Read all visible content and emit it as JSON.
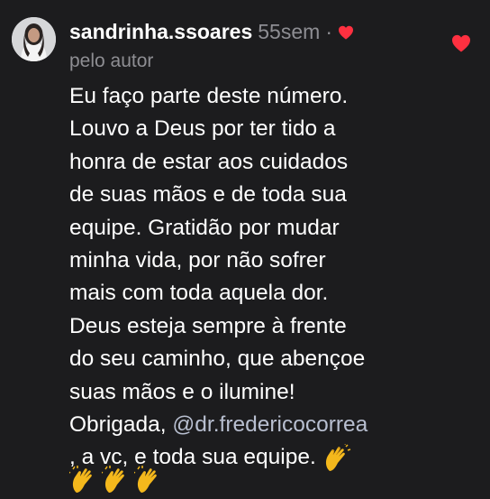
{
  "comment": {
    "username": "sandrinha.ssoares",
    "timestamp": "55sem",
    "separator": "·",
    "author_label": "pelo autor",
    "mention": "@dr.fredericocorrea",
    "lines": [
      "Eu faço parte deste número.",
      "Louvo a Deus por ter tido a",
      "honra de estar aos cuidados",
      "de suas mãos e de toda sua",
      "equipe.  Gratidão por mudar",
      "minha vida,  por não sofrer",
      "mais com toda aquela dor.",
      "Deus esteja sempre à frente",
      "do seu caminho, que abençoe",
      "suas mãos e o ilumine!",
      "Obrigada, ",
      ", a vc, e toda sua equipe. "
    ]
  },
  "icons": {
    "author_heart": "heart-icon",
    "like": "heart-like-icon",
    "clap": "clapping-hands-emoji"
  },
  "colors": {
    "background": "#1c1c1e",
    "text": "#ffffff",
    "muted": "#8e8e93",
    "heart": "#ff3040",
    "mention": "#b8bfd0"
  }
}
